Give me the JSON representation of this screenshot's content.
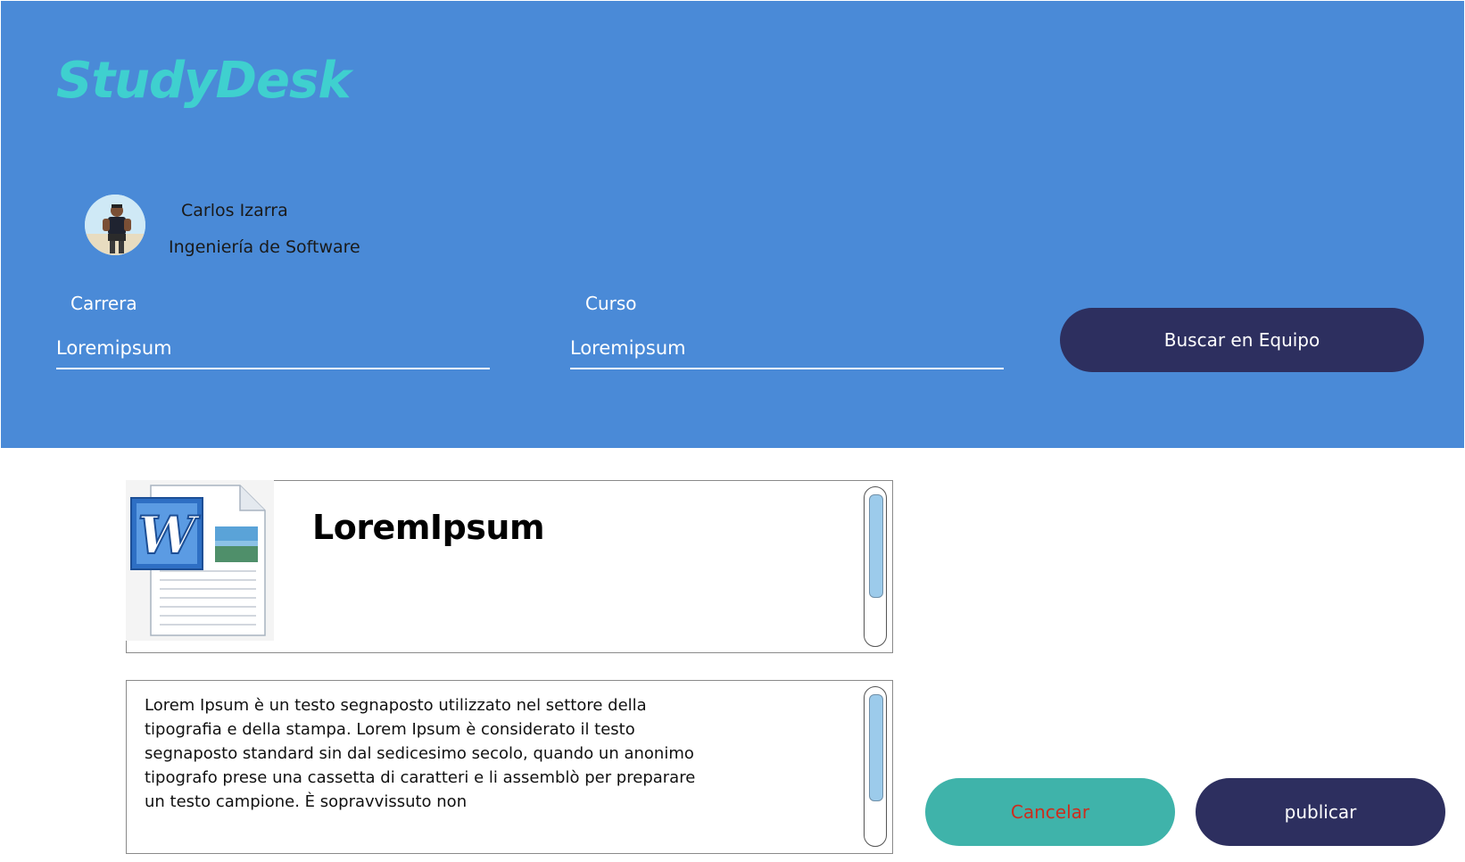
{
  "app": {
    "logo": "StudyDesk"
  },
  "user": {
    "name": "Carlos Izarra",
    "career": "Ingeniería de Software"
  },
  "filters": {
    "carrera_label": "Carrera",
    "carrera_value": "Loremipsum",
    "curso_label": "Curso",
    "curso_value": "Loremipsum",
    "search_button": "Buscar en Equipo"
  },
  "document": {
    "icon": "word-document-icon",
    "title": "LoremIpsum",
    "description": "Lorem Ipsum è un testo segnaposto utilizzato nel settore della tipografia e della stampa. Lorem Ipsum è considerato il testo segnaposto standard sin dal sedicesimo secolo, quando un anonimo tipografo prese una cassetta di caratteri e li assemblò per preparare un testo campione. È sopravvissuto non"
  },
  "actions": {
    "cancel_label": "Cancelar",
    "publish_label": "publicar"
  },
  "colors": {
    "header_bg": "#4a8ad7",
    "logo": "#3fd0cf",
    "primary_button": "#2d2f5f",
    "cancel_button": "#3fb3aa",
    "cancel_text": "#cc2d1e"
  }
}
